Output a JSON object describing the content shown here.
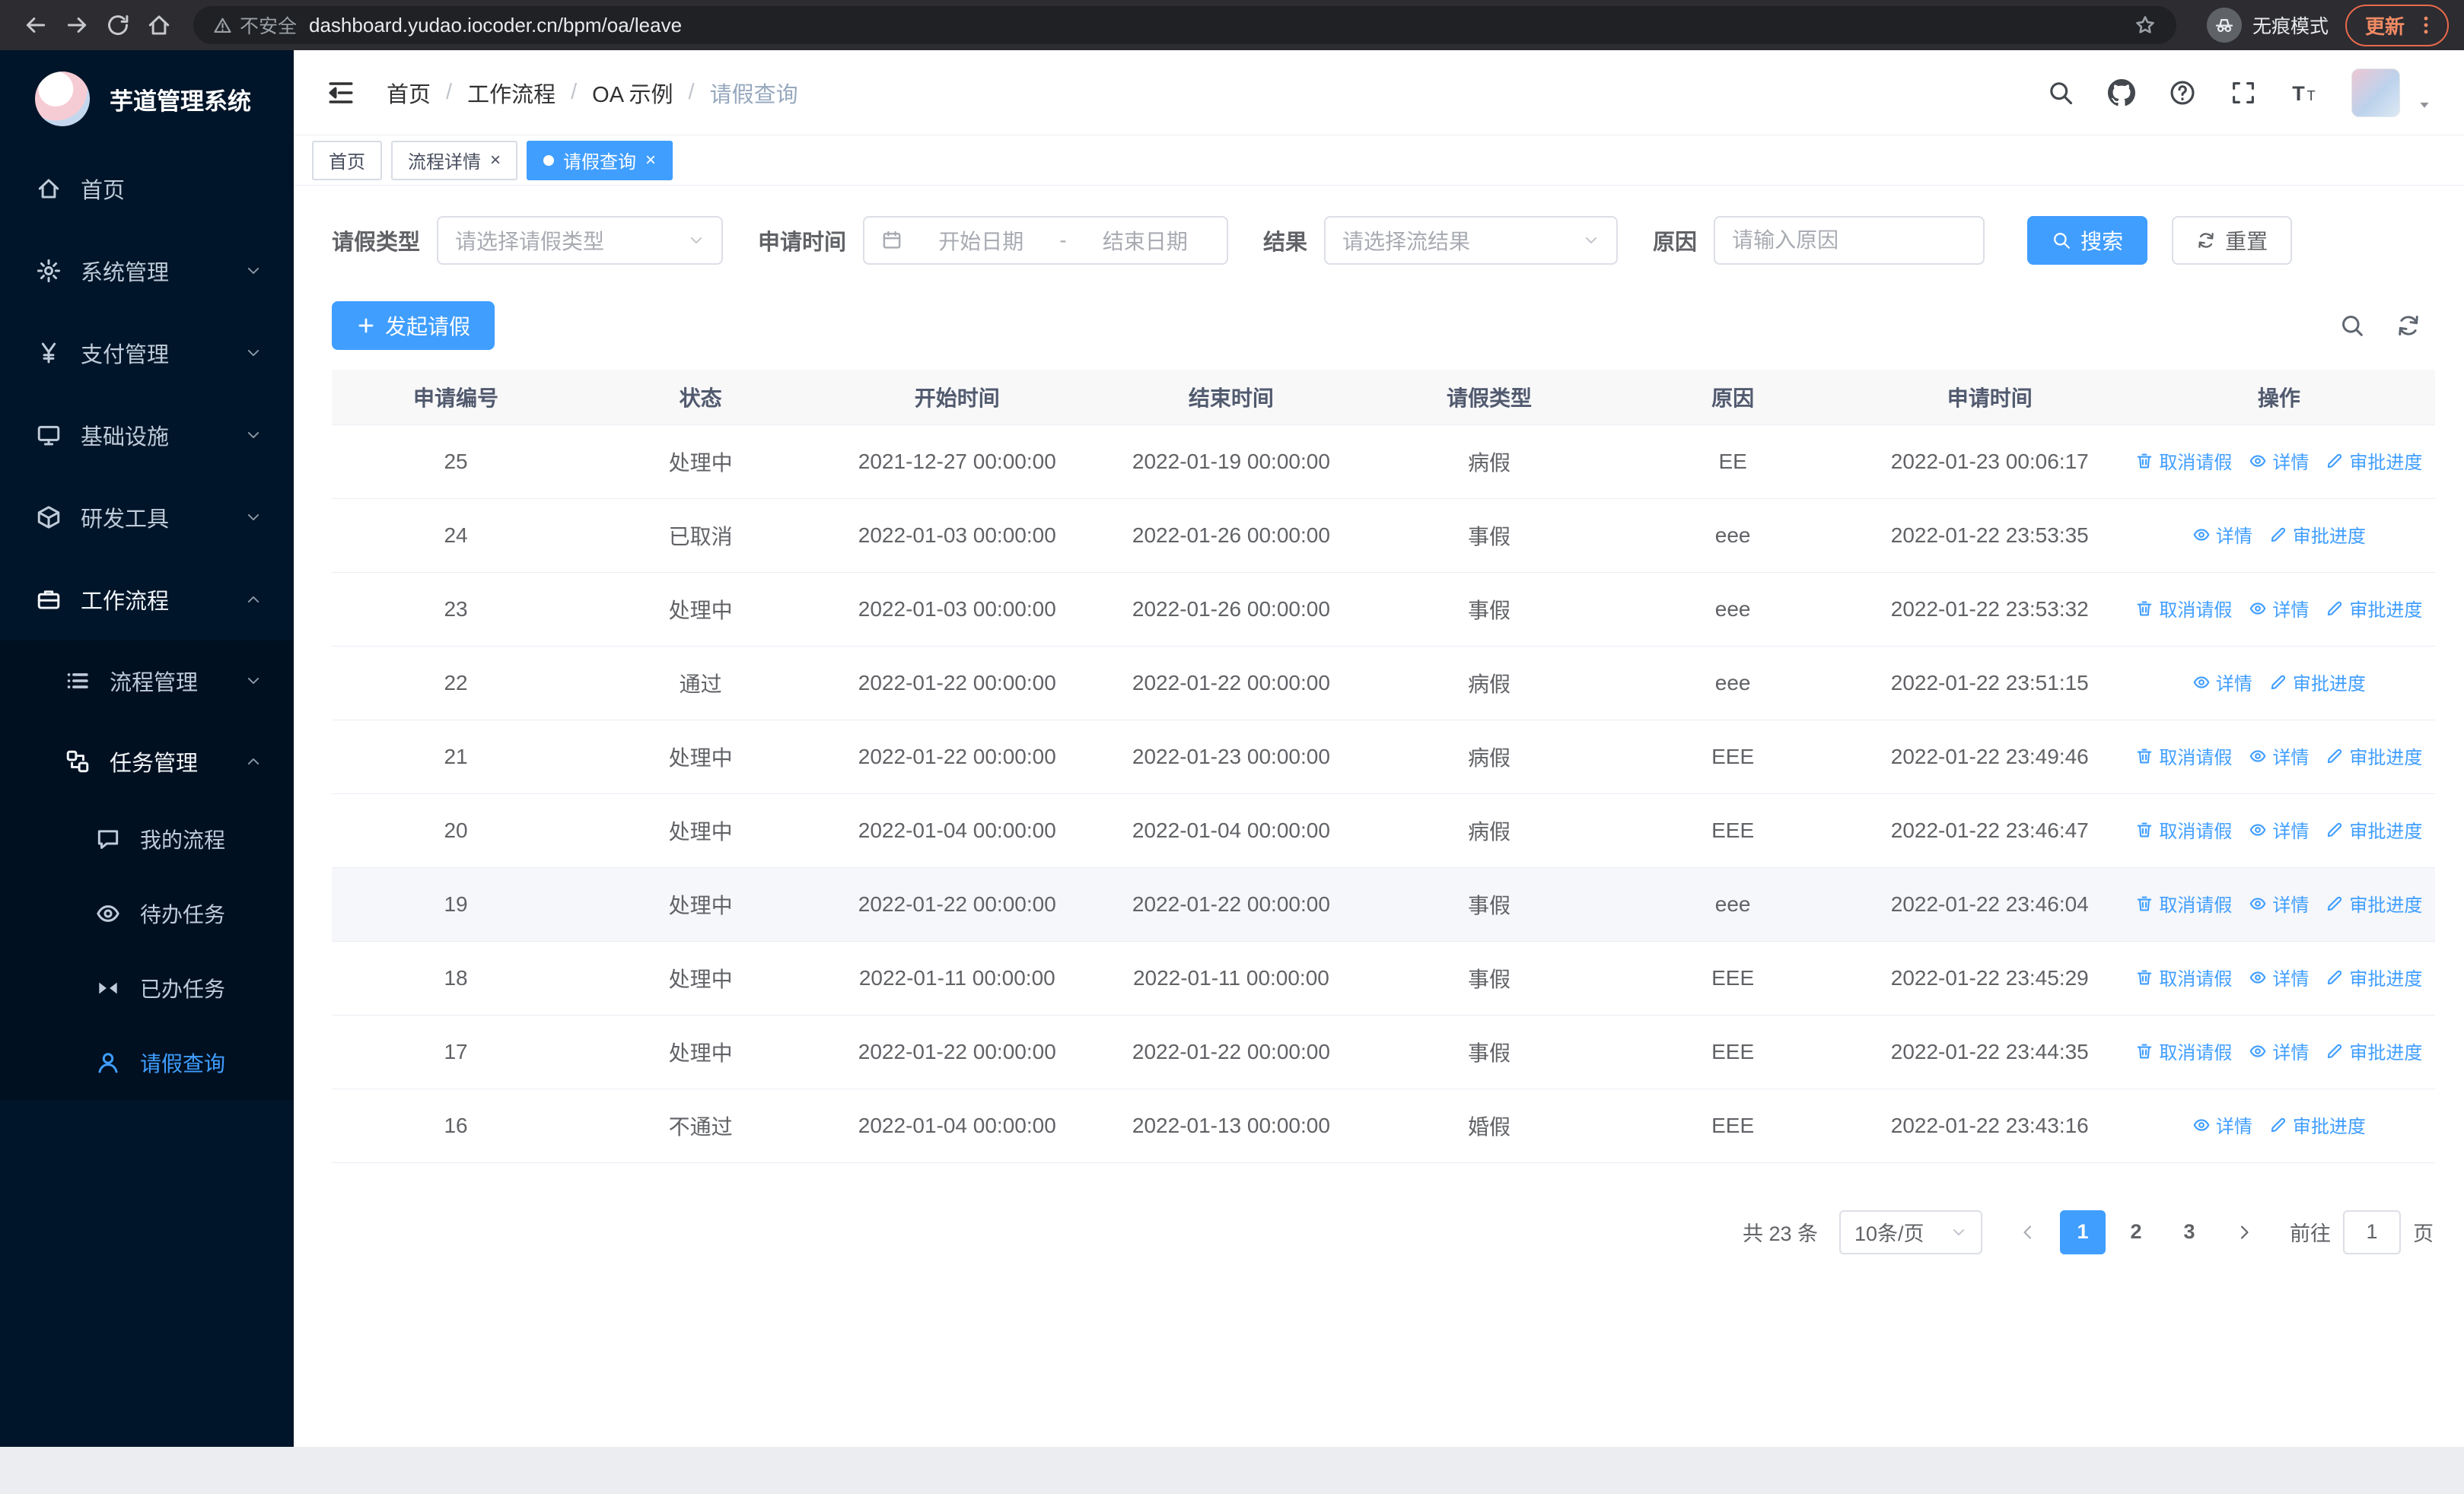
{
  "theme": {
    "accent": "#409eff",
    "sidebar_bg": "#001529",
    "submenu_bg": "#001021"
  },
  "browser": {
    "security_chip": "不安全",
    "url": "dashboard.yudao.iocoder.cn/bpm/oa/leave",
    "incognito_label": "无痕模式",
    "update_label": "更新"
  },
  "sidebar": {
    "app_title": "芋道管理系统",
    "menu": [
      {
        "name": "home",
        "label": "首页",
        "icon": "home-icon",
        "level": 1
      },
      {
        "name": "system-management",
        "label": "系统管理",
        "icon": "gear-icon",
        "level": 1,
        "arrow": "down"
      },
      {
        "name": "payment-management",
        "label": "支付管理",
        "icon": "yen-icon",
        "level": 1,
        "arrow": "down"
      },
      {
        "name": "infrastructure",
        "label": "基础设施",
        "icon": "monitor-icon",
        "level": 1,
        "arrow": "down"
      },
      {
        "name": "dev-tools",
        "label": "研发工具",
        "icon": "cube-icon",
        "level": 1,
        "arrow": "down"
      },
      {
        "name": "workflow",
        "label": "工作流程",
        "icon": "briefcase-icon",
        "level": 1,
        "arrow": "up",
        "open": true
      },
      {
        "name": "process-management",
        "label": "流程管理",
        "icon": "list-icon",
        "level": 2,
        "arrow": "down"
      },
      {
        "name": "task-management",
        "label": "任务管理",
        "icon": "flow-icon",
        "level": 2,
        "arrow": "up",
        "open": true
      },
      {
        "name": "my-process",
        "label": "我的流程",
        "icon": "chat-icon",
        "level": 3
      },
      {
        "name": "todo-tasks",
        "label": "待办任务",
        "icon": "eye-icon",
        "level": 3
      },
      {
        "name": "done-tasks",
        "label": "已办任务",
        "icon": "bowtie-icon",
        "level": 3
      },
      {
        "name": "leave-query",
        "label": "请假查询",
        "icon": "user-icon",
        "level": 3,
        "active": true
      }
    ]
  },
  "header": {
    "breadcrumb": [
      {
        "label": "首页",
        "current": false
      },
      {
        "label": "工作流程",
        "current": false
      },
      {
        "label": "OA 示例",
        "current": false
      },
      {
        "label": "请假查询",
        "current": true
      }
    ]
  },
  "tabs": [
    {
      "name": "home",
      "label": "首页",
      "closable": false,
      "active": false
    },
    {
      "name": "process-detail",
      "label": "流程详情",
      "closable": true,
      "active": false
    },
    {
      "name": "leave-query",
      "label": "请假查询",
      "closable": true,
      "active": true
    }
  ],
  "filters": {
    "leave_type_label": "请假类型",
    "leave_type_placeholder": "请选择请假类型",
    "apply_time_label": "申请时间",
    "start_date_placeholder": "开始日期",
    "range_separator": "-",
    "end_date_placeholder": "结束日期",
    "result_label": "结果",
    "result_placeholder": "请选择流结果",
    "reason_label": "原因",
    "reason_placeholder": "请输入原因",
    "search_button": "搜索",
    "reset_button": "重置"
  },
  "toolbar": {
    "create_label": "发起请假"
  },
  "table": {
    "columns": [
      "申请编号",
      "状态",
      "开始时间",
      "结束时间",
      "请假类型",
      "原因",
      "申请时间",
      "操作"
    ],
    "col_keys": [
      "no",
      "status",
      "start-time",
      "end-time",
      "leave-type",
      "reason",
      "apply-time"
    ],
    "action_labels": {
      "cancel": "取消请假",
      "detail": "详情",
      "progress": "审批进度"
    },
    "rows": [
      {
        "no": "25",
        "status": "处理中",
        "start": "2021-12-27 00:00:00",
        "end": "2022-01-19 00:00:00",
        "type": "病假",
        "reason": "EE",
        "apply_time": "2022-01-23 00:06:17",
        "actions": [
          "cancel",
          "detail",
          "progress"
        ]
      },
      {
        "no": "24",
        "status": "已取消",
        "start": "2022-01-03 00:00:00",
        "end": "2022-01-26 00:00:00",
        "type": "事假",
        "reason": "eee",
        "apply_time": "2022-01-22 23:53:35",
        "actions": [
          "detail",
          "progress"
        ]
      },
      {
        "no": "23",
        "status": "处理中",
        "start": "2022-01-03 00:00:00",
        "end": "2022-01-26 00:00:00",
        "type": "事假",
        "reason": "eee",
        "apply_time": "2022-01-22 23:53:32",
        "actions": [
          "cancel",
          "detail",
          "progress"
        ]
      },
      {
        "no": "22",
        "status": "通过",
        "start": "2022-01-22 00:00:00",
        "end": "2022-01-22 00:00:00",
        "type": "病假",
        "reason": "eee",
        "apply_time": "2022-01-22 23:51:15",
        "actions": [
          "detail",
          "progress"
        ]
      },
      {
        "no": "21",
        "status": "处理中",
        "start": "2022-01-22 00:00:00",
        "end": "2022-01-23 00:00:00",
        "type": "病假",
        "reason": "EEE",
        "apply_time": "2022-01-22 23:49:46",
        "actions": [
          "cancel",
          "detail",
          "progress"
        ]
      },
      {
        "no": "20",
        "status": "处理中",
        "start": "2022-01-04 00:00:00",
        "end": "2022-01-04 00:00:00",
        "type": "病假",
        "reason": "EEE",
        "apply_time": "2022-01-22 23:46:47",
        "actions": [
          "cancel",
          "detail",
          "progress"
        ]
      },
      {
        "no": "19",
        "status": "处理中",
        "start": "2022-01-22 00:00:00",
        "end": "2022-01-22 00:00:00",
        "type": "事假",
        "reason": "eee",
        "apply_time": "2022-01-22 23:46:04",
        "actions": [
          "cancel",
          "detail",
          "progress"
        ],
        "hover": true
      },
      {
        "no": "18",
        "status": "处理中",
        "start": "2022-01-11 00:00:00",
        "end": "2022-01-11 00:00:00",
        "type": "事假",
        "reason": "EEE",
        "apply_time": "2022-01-22 23:45:29",
        "actions": [
          "cancel",
          "detail",
          "progress"
        ]
      },
      {
        "no": "17",
        "status": "处理中",
        "start": "2022-01-22 00:00:00",
        "end": "2022-01-22 00:00:00",
        "type": "事假",
        "reason": "EEE",
        "apply_time": "2022-01-22 23:44:35",
        "actions": [
          "cancel",
          "detail",
          "progress"
        ]
      },
      {
        "no": "16",
        "status": "不通过",
        "start": "2022-01-04 00:00:00",
        "end": "2022-01-13 00:00:00",
        "type": "婚假",
        "reason": "EEE",
        "apply_time": "2022-01-22 23:43:16",
        "actions": [
          "detail",
          "progress"
        ]
      }
    ]
  },
  "pagination": {
    "total": "共 23 条",
    "page_size": "10条/页",
    "pages": [
      "1",
      "2",
      "3"
    ],
    "active_page": "1",
    "goto_label": "前往",
    "goto_value": "1",
    "page_unit": "页"
  }
}
